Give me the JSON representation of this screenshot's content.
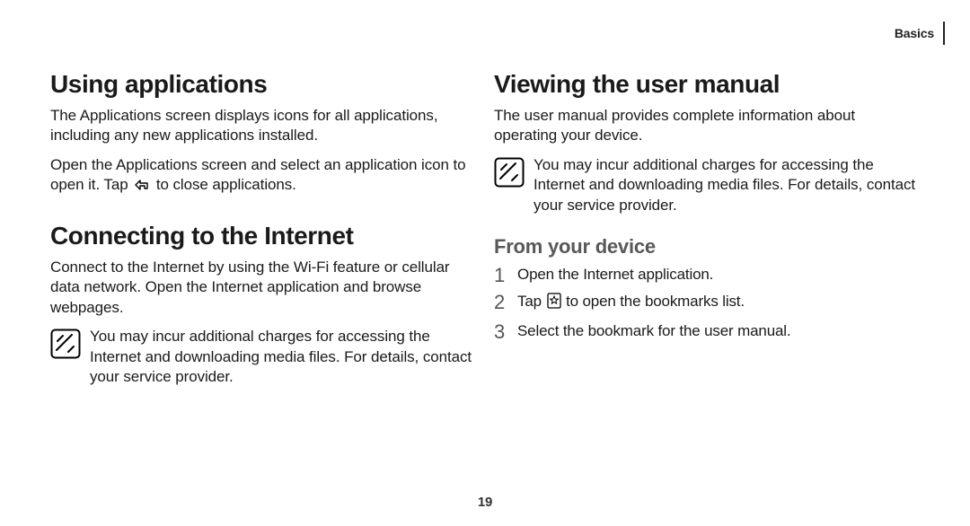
{
  "header": {
    "label": "Basics"
  },
  "left": {
    "h1a": "Using applications",
    "p1": "The Applications screen displays icons for all applications, including any new applications installed.",
    "p2a": "Open the Applications screen and select an application icon to open it. Tap ",
    "p2b": " to close applications.",
    "h1b": "Connecting to the Internet",
    "p3": "Connect to the Internet by using the Wi-Fi feature or cellular data network. Open the Internet application and browse webpages.",
    "note": "You may incur additional charges for accessing the Internet and downloading media files. For details, contact your service provider."
  },
  "right": {
    "h1": "Viewing the user manual",
    "p1": "The user manual provides complete information about operating your device.",
    "note": "You may incur additional charges for accessing the Internet and downloading media files. For details, contact your service provider.",
    "h2": "From your device",
    "steps": {
      "s1": "Open the Internet application.",
      "s2a": "Tap ",
      "s2b": " to open the bookmarks list.",
      "s3": "Select the bookmark for the user manual."
    }
  },
  "pageNumber": "19"
}
